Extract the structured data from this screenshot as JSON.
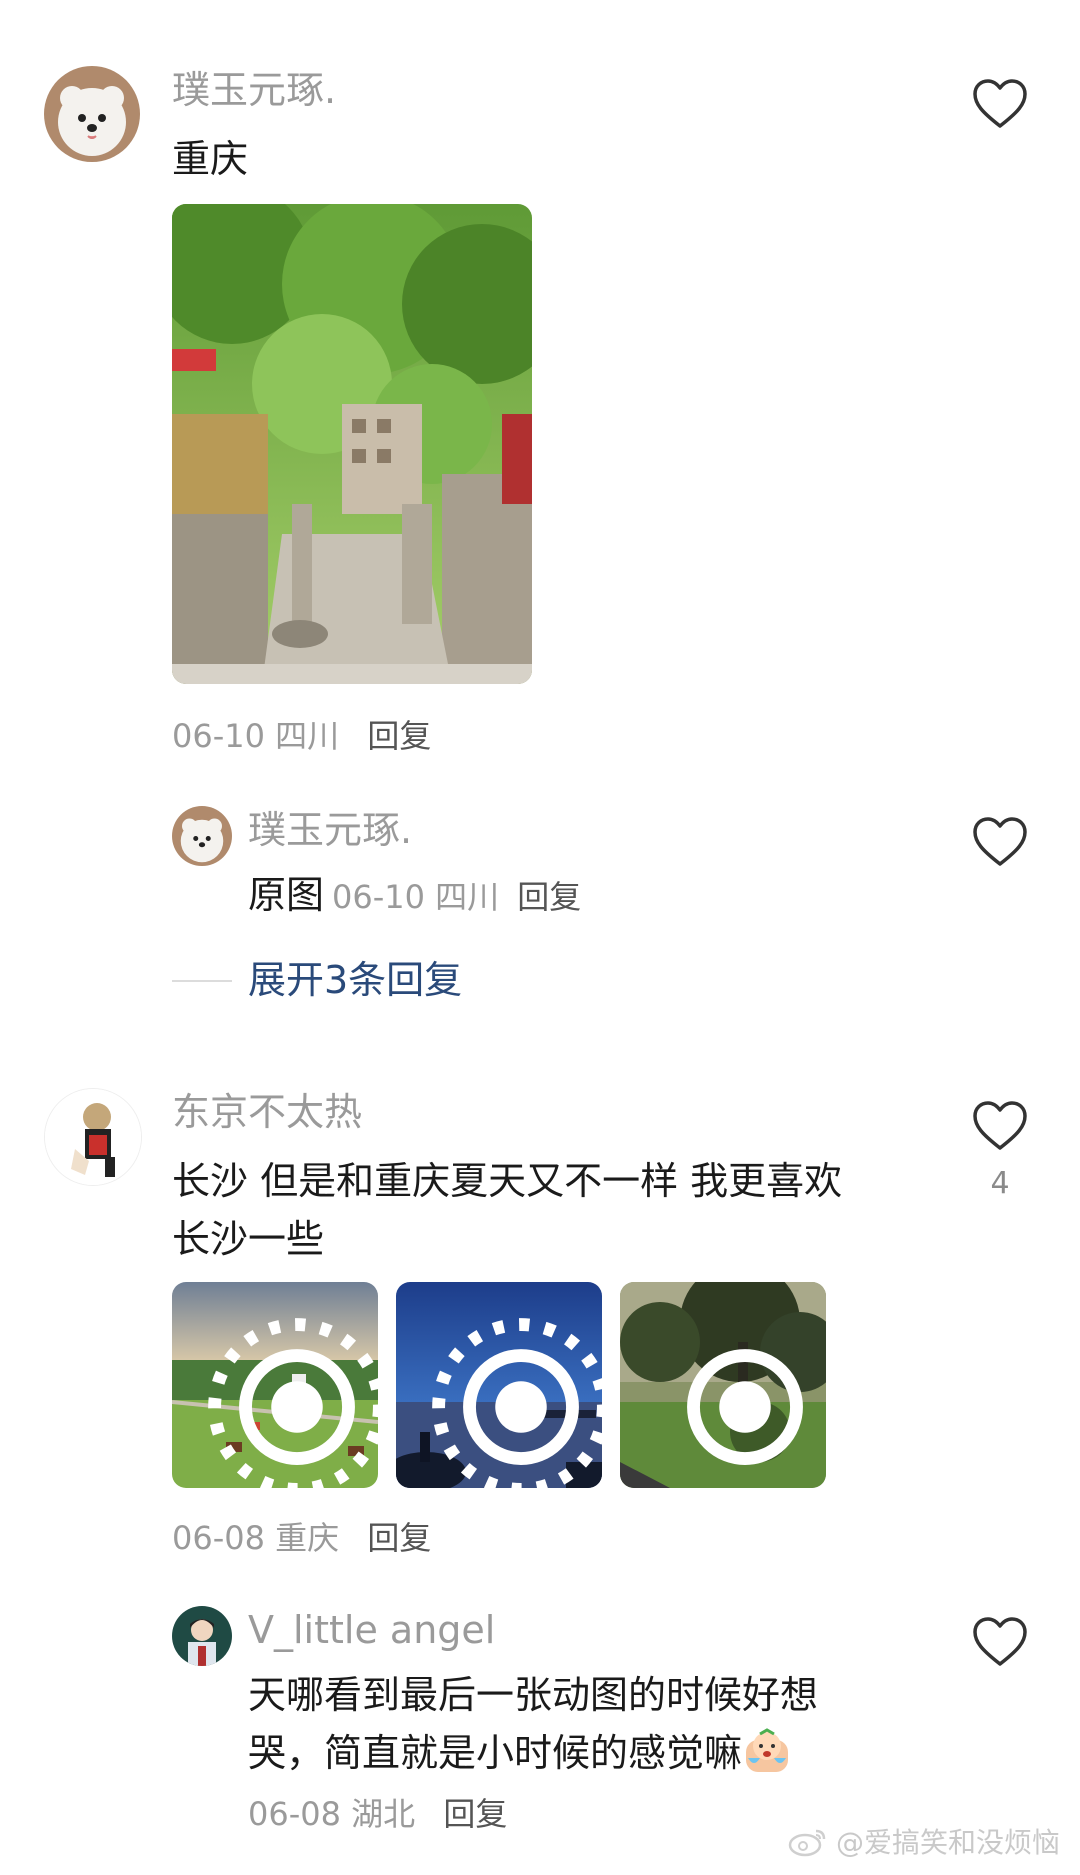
{
  "comments": [
    {
      "username": "璞玉元琢.",
      "text": "重庆",
      "date": "06-10",
      "location": "四川",
      "reply_label": "回复"
    },
    {
      "username": "璞玉元琢.",
      "text": "原图",
      "date": "06-10",
      "location": "四川",
      "reply_label": "回复",
      "expand_label": "展开3条回复"
    },
    {
      "username": "东京不太热",
      "text_line1": "长沙 但是和重庆夏天又不一样 我更喜欢",
      "text_line2": "长沙一些",
      "like_count": "4",
      "date": "06-08",
      "location": "重庆",
      "reply_label": "回复"
    },
    {
      "username": "V_little angel",
      "text_line1": "天哪看到最后一张动图的时候好想",
      "text_line2": "哭，简直就是小时候的感觉嘛",
      "date": "06-08",
      "location": "湖北",
      "reply_label": "回复"
    }
  ],
  "watermark": "@爱搞笑和没烦恼",
  "icons": {
    "like": "heart-outline-icon",
    "live_photo": "live-photo-icon",
    "emoji": "crying-emoji-icon",
    "weibo": "weibo-logo-icon"
  }
}
